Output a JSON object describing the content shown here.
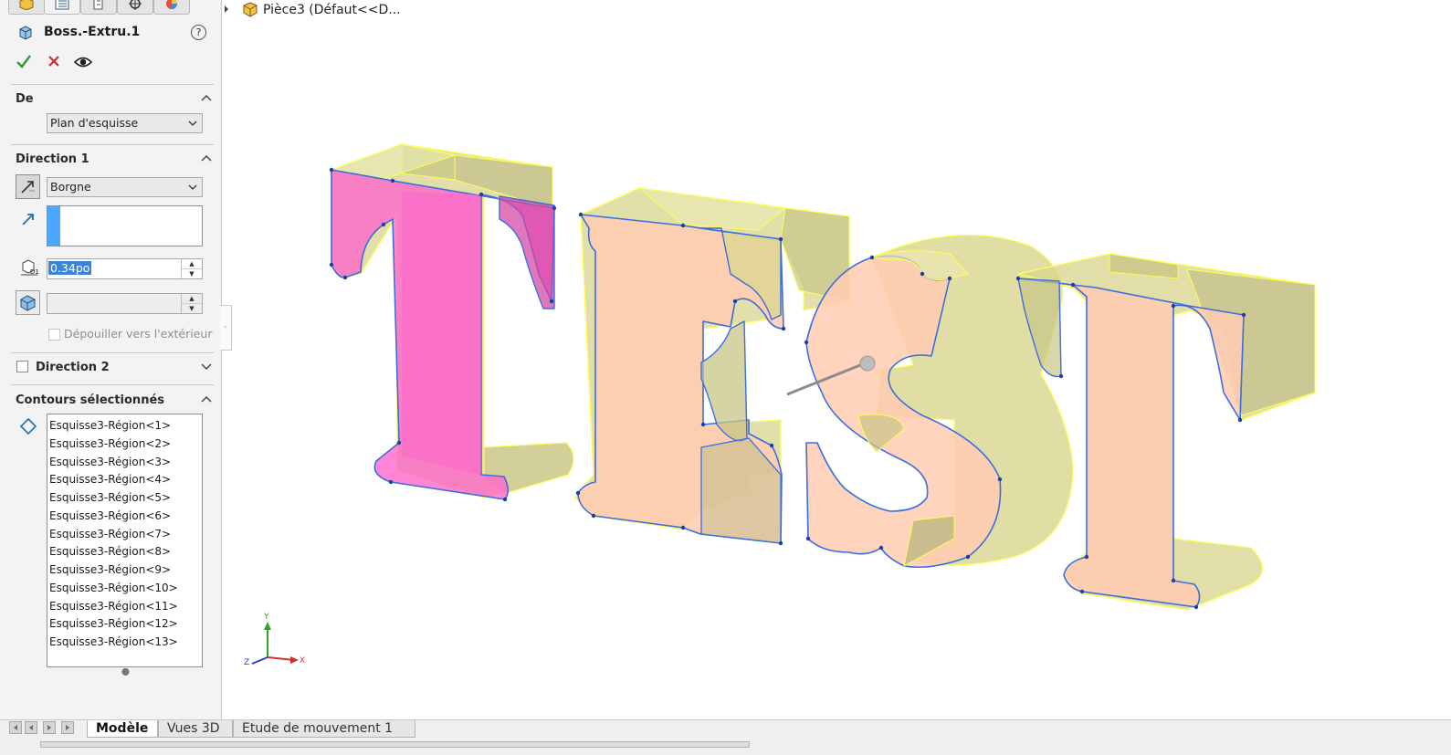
{
  "feature": {
    "title": "Boss.-Extru.1",
    "help": "?"
  },
  "from_section": {
    "title": "De",
    "start_condition": "Plan d'esquisse"
  },
  "direction1": {
    "title": "Direction 1",
    "end_condition": "Borgne",
    "depth": "0.34po",
    "draft_outward_label": "Dépouiller vers l'extérieur"
  },
  "direction2": {
    "title": "Direction 2",
    "checked": false
  },
  "contours": {
    "title": "Contours sélectionnés",
    "items": [
      "Esquisse3-Région<1>",
      "Esquisse3-Région<2>",
      "Esquisse3-Région<3>",
      "Esquisse3-Région<4>",
      "Esquisse3-Région<5>",
      "Esquisse3-Région<6>",
      "Esquisse3-Région<7>",
      "Esquisse3-Région<8>",
      "Esquisse3-Région<9>",
      "Esquisse3-Région<10>",
      "Esquisse3-Région<11>",
      "Esquisse3-Région<12>",
      "Esquisse3-Région<13>"
    ]
  },
  "tree": {
    "root_label": "Pièce3  (Défaut<<D..."
  },
  "triad": {
    "x": "X",
    "y": "Y",
    "z": "Z"
  },
  "bottom_tabs": {
    "model": "Modèle",
    "views3d": "Vues 3D",
    "motion": "Etude de mouvement 1"
  },
  "colors": {
    "accept": "#2e9a35",
    "cancel": "#d12c2c",
    "selection_blue": "#4da6ff",
    "face_pink": "#ff66cc",
    "face_peach": "#ffcbb0",
    "extrude_yellow": "#ffff66",
    "sketch_edge": "#3a6ee0"
  }
}
